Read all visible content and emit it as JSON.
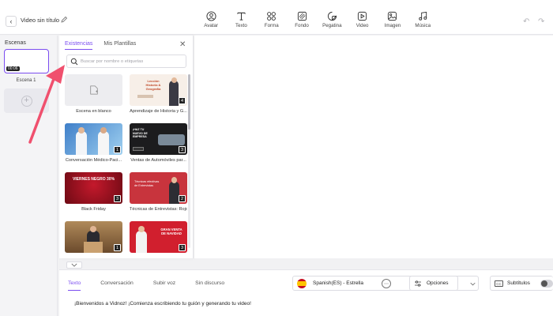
{
  "topbar": {
    "title": "Video sin título",
    "tools": [
      {
        "label": "Avatar",
        "icon": "avatar-icon"
      },
      {
        "label": "Texto",
        "icon": "text-icon"
      },
      {
        "label": "Forma",
        "icon": "shapes-icon"
      },
      {
        "label": "Fondo",
        "icon": "background-icon"
      },
      {
        "label": "Pegatina",
        "icon": "sticker-icon"
      },
      {
        "label": "Video",
        "icon": "video-icon"
      },
      {
        "label": "Imagen",
        "icon": "image-icon"
      },
      {
        "label": "Música",
        "icon": "music-icon"
      }
    ]
  },
  "scenes": {
    "title": "Escenas",
    "items": [
      {
        "time": "00:06",
        "label": "Escena 1"
      }
    ]
  },
  "panel": {
    "tabs": [
      "Existencias",
      "Mis Plantillas"
    ],
    "active_tab": "Existencias",
    "search_placeholder": "Buscar por nombre o etiquetas",
    "templates": [
      {
        "label": "Escena en blanco",
        "count": ""
      },
      {
        "label": "Aprendizaje de Historia y G...",
        "count": "4",
        "thumb_text": "Lección\nHistoria & Geografía"
      },
      {
        "label": "Conversación Médico-Paci...",
        "count": "1"
      },
      {
        "label": "Ventas de Automóviles par...",
        "count": "3",
        "thumb_text": "¡HAZ TU NUEVO DE EMPRESA"
      },
      {
        "label": "Black Friday",
        "count": "3",
        "thumb_text": "VIERNES NEGRO 30%"
      },
      {
        "label": "Técnicas de Entrevistas: Rojo",
        "count": "2",
        "thumb_text": "Técnicas efectivas de Entrevistas"
      },
      {
        "label": "",
        "count": "1"
      },
      {
        "label": "",
        "count": "3",
        "thumb_text": "GRAN VENTA DE NAVIDAD"
      }
    ]
  },
  "script": {
    "tabs": [
      "Texto",
      "Conversación",
      "Subir voz",
      "Sin discurso"
    ],
    "active_tab": "Texto",
    "voice": "Spanish(ES) - Estrella",
    "options_label": "Opciones",
    "subtitles_label": "Subtítulos",
    "subtitles_on": false,
    "cc_badge": "CC",
    "text": "¡Bienvenidos a Vidnoz! ¡Comienza escribiendo tu guión y generando tu video!"
  },
  "colors": {
    "accent": "#7b4df0",
    "arrow": "#f0506e"
  }
}
